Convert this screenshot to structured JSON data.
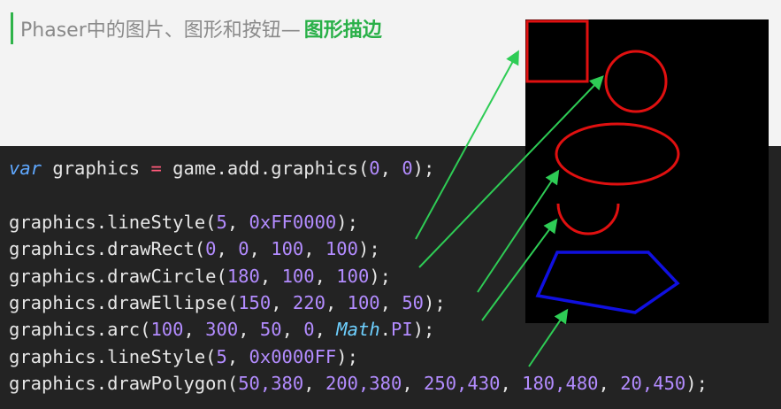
{
  "title": {
    "main": "Phaser中的图片、图形和按钮— ",
    "accent": "图形描边"
  },
  "code": {
    "line1": {
      "kw": "var",
      "a": " graphics ",
      "op": "=",
      "b": " game.add.graphics(",
      "n1": "0",
      "c": ", ",
      "n2": "0",
      "d": ");"
    },
    "line3": {
      "a": "graphics.lineStyle(",
      "n1": "5",
      "b": ", ",
      "n2": "0xFF0000",
      "c": ");"
    },
    "line4": {
      "a": "graphics.drawRect(",
      "n1": "0",
      "b": ", ",
      "n2": "0",
      "c": ", ",
      "n3": "100",
      "d": ", ",
      "n4": "100",
      "e": ");"
    },
    "line5": {
      "a": "graphics.drawCircle(",
      "n1": "180",
      "b": ", ",
      "n2": "100",
      "c": ", ",
      "n3": "100",
      "d": ");"
    },
    "line6": {
      "a": "graphics.drawEllipse(",
      "n1": "150",
      "b": ", ",
      "n2": "220",
      "c": ", ",
      "n3": "100",
      "d": ", ",
      "n4": "50",
      "e": ");"
    },
    "line7": {
      "a": "graphics.arc(",
      "n1": "100",
      "b": ", ",
      "n2": "300",
      "c": ", ",
      "n3": "50",
      "d": ", ",
      "n4": "0",
      "e": ", ",
      "cls": "Math",
      "f": ".",
      "g": "PI",
      "h": ");"
    },
    "line8": {
      "a": "graphics.lineStyle(",
      "n1": "5",
      "b": ", ",
      "n2": "0x0000FF",
      "c": ");"
    },
    "line9": {
      "a": "graphics.drawPolygon(",
      "n1": "50,380",
      "b": ", ",
      "n2": "200,380",
      "c": ", ",
      "n3": "250,430",
      "d": ", ",
      "n4": "180,480",
      "e": ", ",
      "n5": "20,450",
      "f": ");"
    }
  },
  "colors": {
    "accent": "#29b048",
    "stroke_red": "#e01010",
    "stroke_blue": "#1010e0",
    "arrow_green": "#2ecc55",
    "canvas_bg": "#000000",
    "code_bg": "#232323"
  }
}
